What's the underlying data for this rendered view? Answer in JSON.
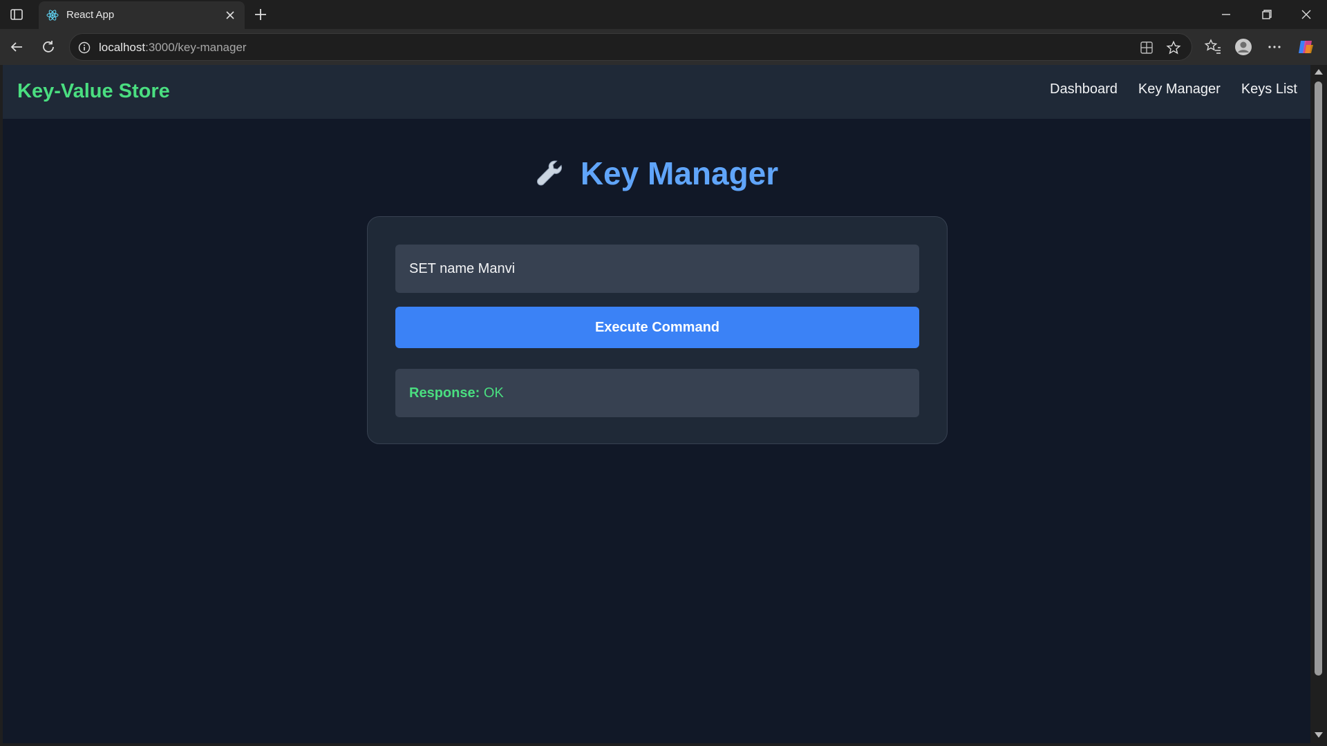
{
  "browser": {
    "tab_title": "React App",
    "url_host": "localhost",
    "url_path": ":3000/key-manager"
  },
  "app": {
    "brand": "Key-Value Store",
    "nav": [
      "Dashboard",
      "Key Manager",
      "Keys List"
    ],
    "heading": "Key Manager",
    "heading_icon": "wrench-icon",
    "command_input_value": "SET name Manvi",
    "execute_label": "Execute Command",
    "response_label": "Response:",
    "response_value": "OK"
  },
  "colors": {
    "page_bg": "#111827",
    "nav_bg": "#1f2937",
    "brand": "#4ade80",
    "heading": "#60a5fa",
    "button": "#3b82f6"
  }
}
